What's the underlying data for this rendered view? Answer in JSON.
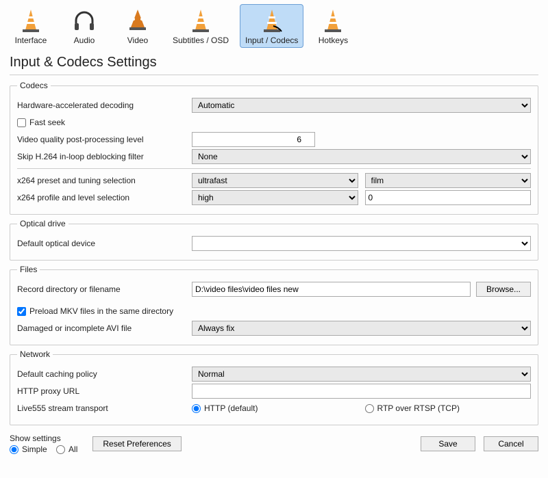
{
  "toolbar": {
    "items": [
      {
        "label": "Interface"
      },
      {
        "label": "Audio"
      },
      {
        "label": "Video"
      },
      {
        "label": "Subtitles / OSD"
      },
      {
        "label": "Input / Codecs",
        "selected": true
      },
      {
        "label": "Hotkeys"
      }
    ]
  },
  "page": {
    "title": "Input & Codecs Settings"
  },
  "codecs": {
    "legend": "Codecs",
    "hw_label": "Hardware-accelerated decoding",
    "hw_value": "Automatic",
    "fast_seek_label": "Fast seek",
    "fast_seek_checked": false,
    "vq_label": "Video quality post-processing level",
    "vq_value": "6",
    "skip_label": "Skip H.264 in-loop deblocking filter",
    "skip_value": "None",
    "x264_preset_label": "x264 preset and tuning selection",
    "x264_preset_value": "ultrafast",
    "x264_tuning_value": "film",
    "x264_profile_label": "x264 profile and level selection",
    "x264_profile_value": "high",
    "x264_level_value": "0"
  },
  "optical": {
    "legend": "Optical drive",
    "default_label": "Default optical device",
    "default_value": ""
  },
  "files": {
    "legend": "Files",
    "record_label": "Record directory or filename",
    "record_value": "D:\\video files\\video files new",
    "browse_label": "Browse...",
    "preload_label": "Preload MKV files in the same directory",
    "preload_checked": true,
    "damaged_label": "Damaged or incomplete AVI file",
    "damaged_value": "Always fix"
  },
  "network": {
    "legend": "Network",
    "caching_label": "Default caching policy",
    "caching_value": "Normal",
    "proxy_label": "HTTP proxy URL",
    "proxy_value": "",
    "live555_label": "Live555 stream transport",
    "http_label": "HTTP (default)",
    "rtp_label": "RTP over RTSP (TCP)",
    "live555_selected": "http"
  },
  "footer": {
    "show_settings_label": "Show settings",
    "simple_label": "Simple",
    "all_label": "All",
    "show_selected": "simple",
    "reset_label": "Reset Preferences",
    "save_label": "Save",
    "cancel_label": "Cancel"
  }
}
